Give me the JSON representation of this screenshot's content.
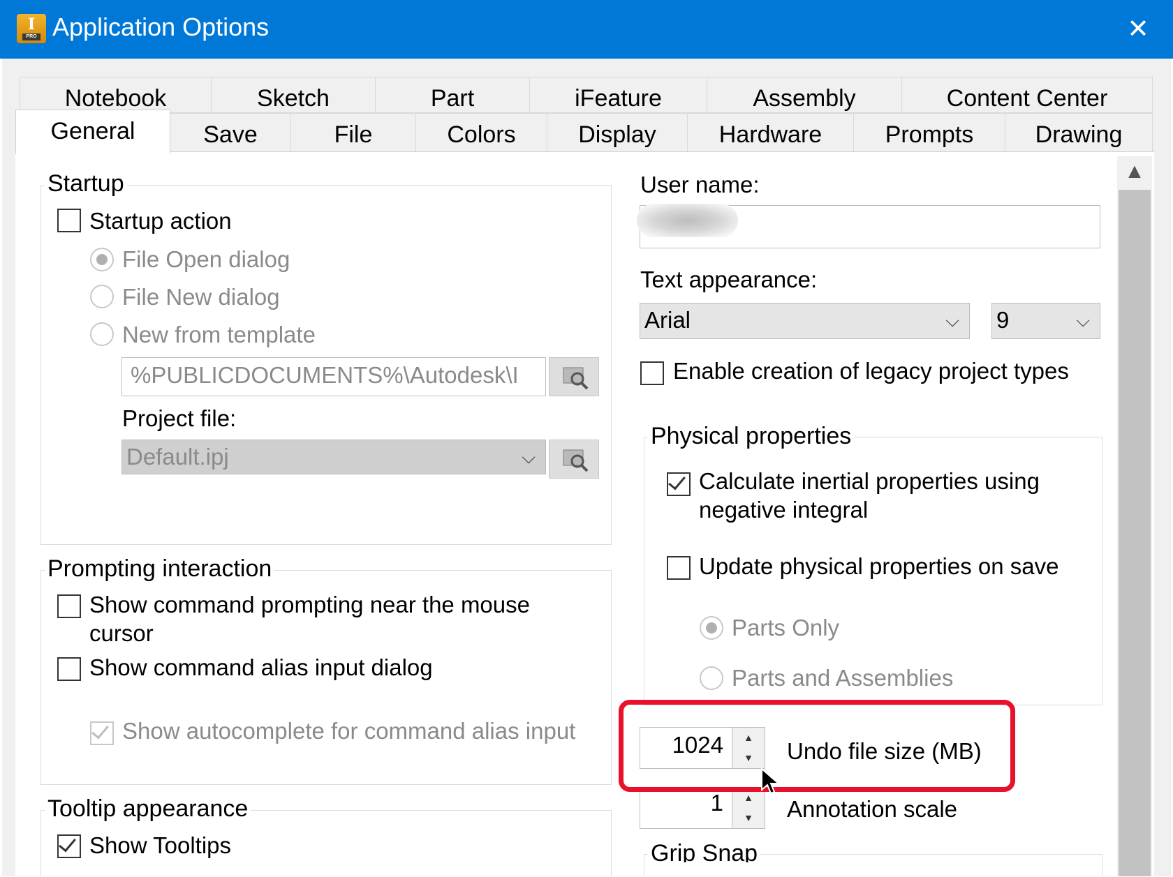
{
  "window": {
    "title": "Application Options",
    "close_label": "✕"
  },
  "tabs": {
    "row1": [
      "Notebook",
      "Sketch",
      "Part",
      "iFeature",
      "Assembly",
      "Content Center"
    ],
    "row2": [
      "General",
      "Save",
      "File",
      "Colors",
      "Display",
      "Hardware",
      "Prompts",
      "Drawing"
    ],
    "active": "General"
  },
  "startup": {
    "legend": "Startup",
    "startup_action": {
      "label": "Startup action",
      "checked": false
    },
    "radios": [
      {
        "label": "File Open dialog",
        "selected": true
      },
      {
        "label": "File New dialog",
        "selected": false
      },
      {
        "label": "New from template",
        "selected": false
      }
    ],
    "template_path": "%PUBLICDOCUMENTS%\\Autodesk\\I",
    "project_file_label": "Project file:",
    "project_file_value": "Default.ipj"
  },
  "prompting": {
    "legend": "Prompting interaction",
    "show_prompting_line1": "Show command prompting near the mouse",
    "show_prompting_line2": "cursor",
    "show_alias_dialog": "Show command alias input dialog",
    "show_autocomplete": "Show autocomplete for command alias input"
  },
  "tooltip": {
    "legend": "Tooltip appearance",
    "show_tooltips": "Show Tooltips"
  },
  "user": {
    "label": "User name:"
  },
  "text_appearance": {
    "label": "Text appearance:",
    "font": "Arial",
    "size": "9"
  },
  "legacy": {
    "label": "Enable creation of legacy project types"
  },
  "physical": {
    "legend": "Physical properties",
    "calc_line1": "Calculate inertial properties using",
    "calc_line2": "negative integral",
    "update_on_save": "Update physical properties on save",
    "parts_only": "Parts Only",
    "parts_assemblies": "Parts and Assemblies"
  },
  "undo": {
    "value": "1024",
    "label": "Undo file size (MB)"
  },
  "annotation": {
    "value": "1",
    "label": "Annotation scale"
  },
  "grip_snap": {
    "legend": "Grip Snap"
  },
  "icons": {
    "scroll_up": "▲",
    "dropdown": "⌵",
    "spin_up": "▲",
    "spin_down": "▼",
    "check": "✓"
  },
  "colors": {
    "titlebar": "#0078d7",
    "highlight": "#e8102a"
  }
}
